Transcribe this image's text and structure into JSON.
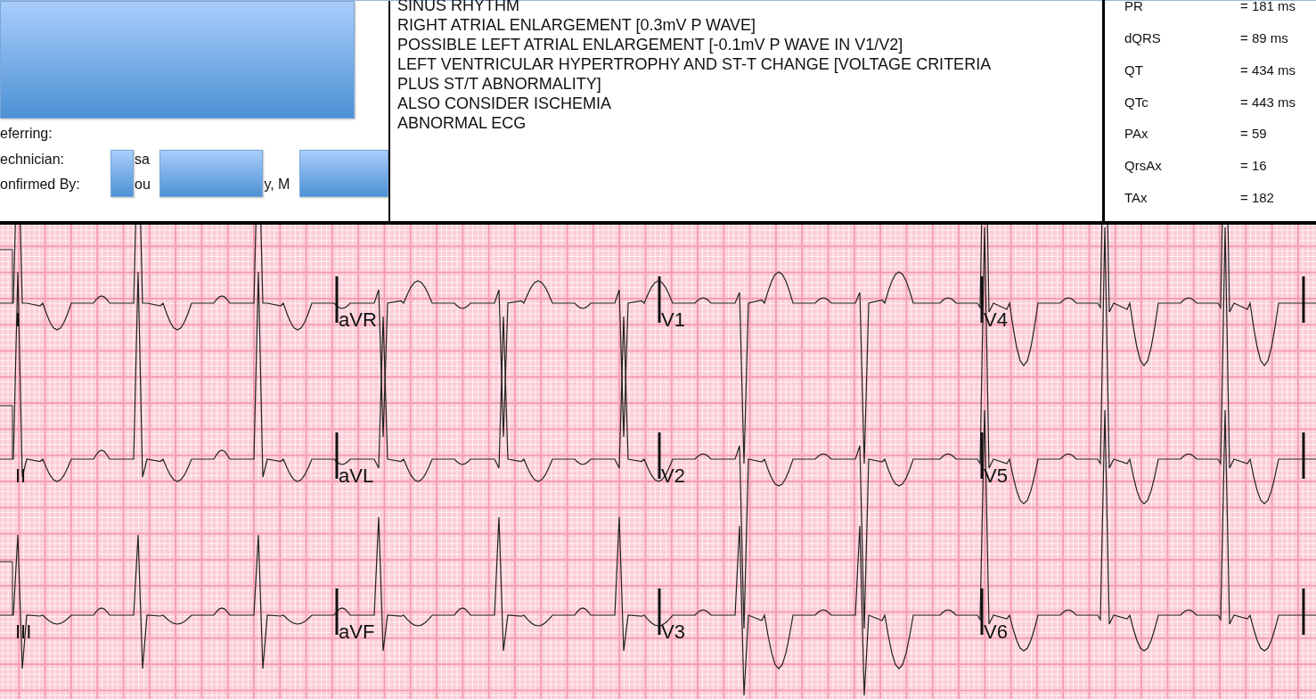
{
  "staff_fields": [
    {
      "label": "eferring:"
    },
    {
      "label": "echnician:",
      "visible_text": [
        "sa"
      ]
    },
    {
      "label": "onfirmed By:",
      "visible_text": [
        "ou",
        "y, M"
      ]
    }
  ],
  "interpretation": [
    "SINUS RHYTHM",
    "RIGHT ATRIAL ENLARGEMENT [0.3mV P WAVE]",
    "POSSIBLE LEFT ATRIAL ENLARGEMENT [-0.1mV P WAVE IN V1/V2]",
    "LEFT VENTRICULAR HYPERTROPHY AND ST-T CHANGE [VOLTAGE CRITERIA",
    "PLUS ST/T ABNORMALITY]",
    "ALSO CONSIDER ISCHEMIA",
    "ABNORMAL ECG"
  ],
  "measurements": [
    {
      "name": "PR",
      "value": "= 181 ms"
    },
    {
      "name": "dQRS",
      "value": "= 89 ms"
    },
    {
      "name": "QT",
      "value": "= 434 ms"
    },
    {
      "name": "QTc",
      "value": "= 443 ms"
    },
    {
      "name": "PAx",
      "value": "= 59"
    },
    {
      "name": "QrsAx",
      "value": "= 16"
    },
    {
      "name": "TAx",
      "value": "= 182"
    }
  ],
  "lead_rows": [
    [
      "I",
      "aVR",
      "V1",
      "V4"
    ],
    [
      "II",
      "aVL",
      "V2",
      "V5"
    ],
    [
      "III",
      "aVF",
      "V3",
      "V6"
    ]
  ]
}
